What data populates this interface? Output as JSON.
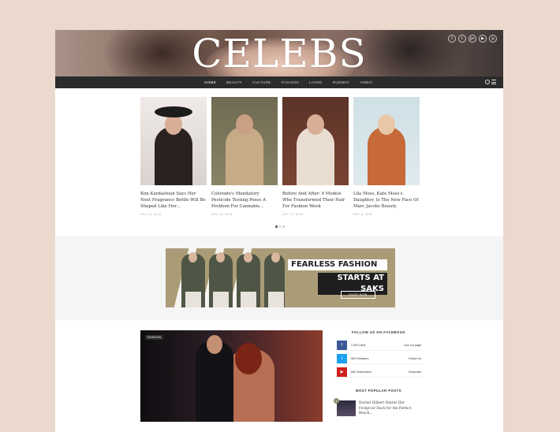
{
  "site": {
    "logo": "CELEBS",
    "socials": [
      {
        "icon": "facebook-icon",
        "glyph": "f"
      },
      {
        "icon": "twitter-icon",
        "glyph": "t"
      },
      {
        "icon": "google-plus-icon",
        "glyph": "g+"
      },
      {
        "icon": "youtube-icon",
        "glyph": "▶"
      },
      {
        "icon": "instagram-icon",
        "glyph": "◎"
      }
    ]
  },
  "nav": {
    "items": [
      "HOME",
      "BEAUTY",
      "CULTURE",
      "FASHION",
      "LIVING",
      "RUNWAY",
      "VIDEO"
    ],
    "active": "HOME"
  },
  "featured": [
    {
      "title": "Kim Kardashian Says Her Next Fragrance Bottle Will Be Shaped Like Her…",
      "date": "DEC 16, 2016"
    },
    {
      "title": "Colorado's Mandatory Pesticide Testing Poses A Problem For Cannabis…",
      "date": "DEC 12, 2016"
    },
    {
      "title": "Before And After: 9 Models Who Transformed Their Hair For Fashion Week",
      "date": "DEC 12, 2016"
    },
    {
      "title": "Lila Moss, Kate Moss's Daughter, Is The New Face Of Marc Jacobs Beauty",
      "date": "DEC 6, 2016"
    }
  ],
  "ad": {
    "line1": "FEARLESS FASHION",
    "line2": "STARTS AT SAKS",
    "cta": "SHOP NOW"
  },
  "main_post": {
    "tag": "FASHION"
  },
  "sidebar": {
    "facebook_heading": "FOLLOW US ON FACEBOOK",
    "social_rows": [
      {
        "icon": "facebook-icon",
        "glyph": "f",
        "color": "#3b5998",
        "count": "2,453 Likes",
        "action": "Like our page"
      },
      {
        "icon": "twitter-icon",
        "glyph": "t",
        "color": "#1da1f2",
        "count": "553 Followers",
        "action": "Follow Us"
      },
      {
        "icon": "youtube-icon",
        "glyph": "▶",
        "color": "#cd201f",
        "count": "582 Subscribers",
        "action": "Subscribe"
      }
    ],
    "popular_heading": "MOST POPULAR POSTS",
    "popular": [
      {
        "num": "1",
        "title": "Rachel Hilbert Shares Her Foolproof Hack for the Perfect Beach…"
      }
    ]
  },
  "colors": {
    "page_bg": "#ecd9cd",
    "nav_bg": "#2b2b2b",
    "ad_bg": "#a99c77"
  }
}
